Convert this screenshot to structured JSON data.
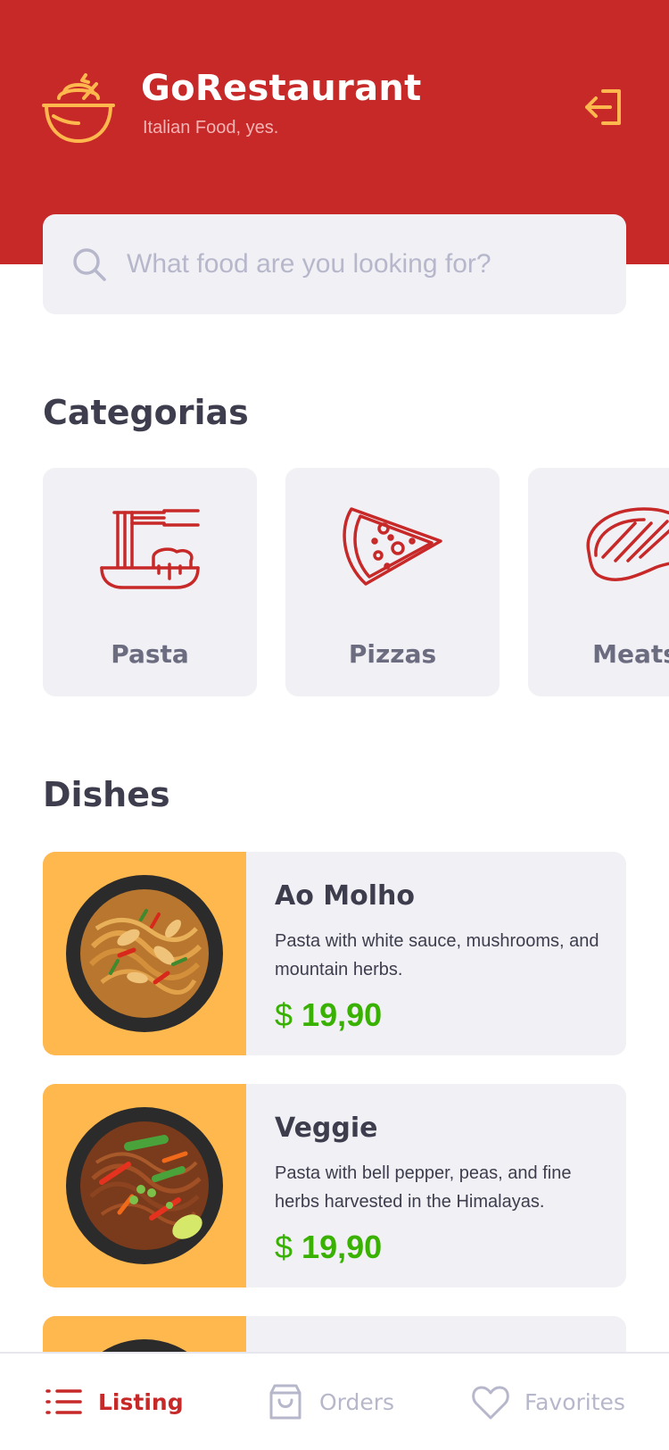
{
  "colors": {
    "primary": "#c72828",
    "accent": "#ffb84d",
    "card_bg": "#f0f0f5",
    "text_dark": "#3d3d4d",
    "text_muted": "#6c6c80",
    "placeholder": "#b7b7cc",
    "price_green": "#39b100"
  },
  "header": {
    "title": "GoRestaurant",
    "subtitle": "Italian Food, yes.",
    "logo_icon": "cooking-pot-icon",
    "logout_icon": "logout-icon"
  },
  "search": {
    "placeholder": "What food are you looking for?",
    "value": "",
    "icon": "search-icon"
  },
  "categories": {
    "title": "Categorias",
    "items": [
      {
        "label": "Pasta",
        "icon": "pasta-icon"
      },
      {
        "label": "Pizzas",
        "icon": "pizza-slice-icon"
      },
      {
        "label": "Meats",
        "icon": "steak-icon"
      }
    ]
  },
  "dishes": {
    "title": "Dishes",
    "items": [
      {
        "name": "Ao Molho",
        "description": "Pasta with white sauce, mushrooms, and mountain herbs.",
        "currency": "$",
        "price": "19,90"
      },
      {
        "name": "Veggie",
        "description": "Pasta with bell pepper, peas, and fine herbs harvested in the Himalayas.",
        "currency": "$",
        "price": "19,90"
      },
      {
        "name": "",
        "description": "",
        "currency": "",
        "price": ""
      }
    ]
  },
  "tabbar": {
    "tabs": [
      {
        "label": "Listing",
        "icon": "list-icon",
        "active": true
      },
      {
        "label": "Orders",
        "icon": "shopping-bag-icon",
        "active": false
      },
      {
        "label": "Favorites",
        "icon": "heart-icon",
        "active": false
      }
    ]
  }
}
